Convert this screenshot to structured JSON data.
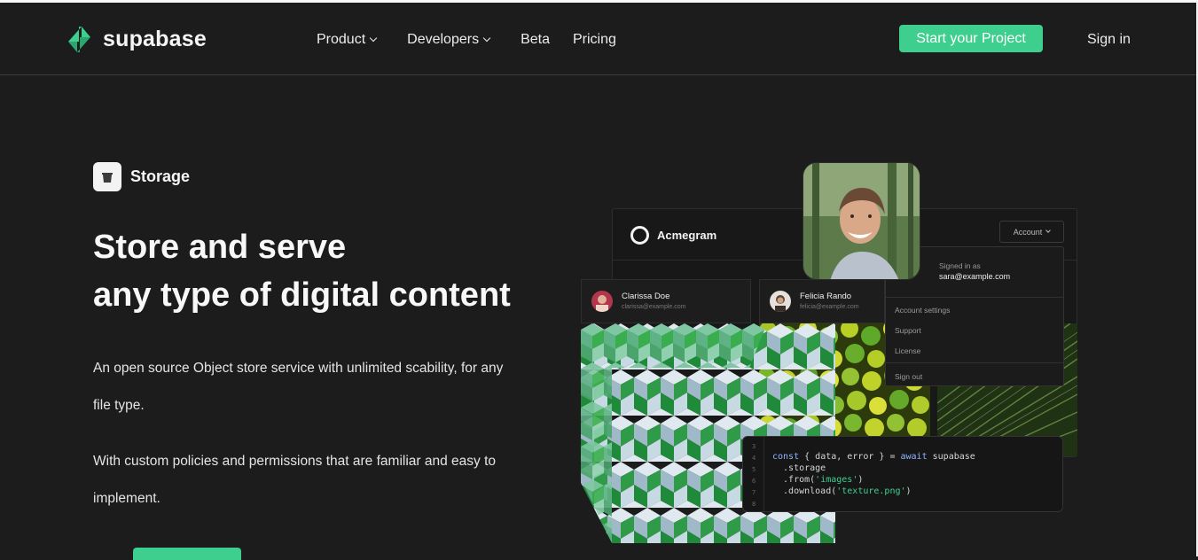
{
  "header": {
    "brand": "supabase",
    "nav": [
      {
        "label": "Product",
        "has_dropdown": true
      },
      {
        "label": "Developers",
        "has_dropdown": true
      },
      {
        "label": "Beta",
        "has_dropdown": false
      },
      {
        "label": "Pricing",
        "has_dropdown": false
      }
    ],
    "cta_label": "Start your Project",
    "signin_label": "Sign in"
  },
  "colors": {
    "brand": "#3ecf8e",
    "background": "#1c1c1c"
  },
  "hero": {
    "badge_icon": "bucket-icon",
    "badge_label": "Storage",
    "title_line1": "Store and serve",
    "title_line2": "any type of digital content",
    "paragraph1": "An open source Object store service with unlimited scability, for any file type.",
    "paragraph2": "With custom policies and permissions that are familiar and easy to implement."
  },
  "mock_app": {
    "name": "Acmegram",
    "account_button": "Account",
    "dropdown": {
      "signed_in_label": "Signed in as",
      "email": "sara@example.com",
      "items": [
        "Account settings",
        "Support",
        "License"
      ],
      "sign_out": "Sign out"
    },
    "users": [
      {
        "name": "Clarissa Doe",
        "email": "clarissa@example.com"
      },
      {
        "name": "Felicia Rando",
        "email": "felicia@example.com"
      }
    ],
    "code": {
      "line_numbers": [
        "3",
        "4",
        "5",
        "6",
        "7",
        "8"
      ],
      "l4_a": "const",
      "l4_b": " { data, error } = ",
      "l4_c": "await",
      "l4_d": " supabase",
      "l5": "  .storage",
      "l6_a": "  .from(",
      "l6_b": "'images'",
      "l6_c": ")",
      "l7_a": "  .download(",
      "l7_b": "'texture.png'",
      "l7_c": ")"
    }
  }
}
